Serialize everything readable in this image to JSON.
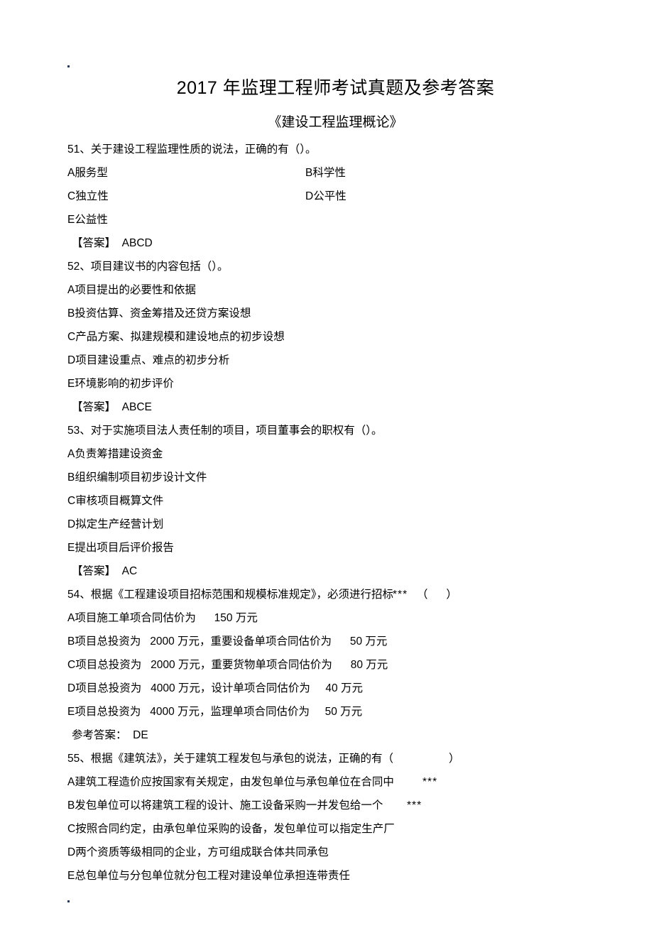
{
  "document": {
    "title": "2017 年监理工程师考试真题及参考答案",
    "subtitle": "《建设工程监理概论》",
    "margin_mark": "."
  },
  "questions": [
    {
      "stem": "51、关于建设工程监理性质的说法，正确的有（）。",
      "two_column": true,
      "options_left": [
        "A服务型",
        "C独立性",
        "E公益性"
      ],
      "options_right": [
        "B科学性",
        "D公平性",
        ""
      ],
      "answer_label": "【答案】",
      "answer_value": "ABCD"
    },
    {
      "stem": "52、项目建议书的内容包括（）。",
      "two_column": false,
      "options": [
        "A项目提出的必要性和依据",
        "B投资估算、资金筹措及还贷方案设想",
        "C产品方案、拟建规模和建设地点的初步设想",
        "D项目建设重点、难点的初步分析",
        "E环境影响的初步评价"
      ],
      "answer_label": "【答案】",
      "answer_value": "ABCE"
    },
    {
      "stem": "53、对于实施项目法人责任制的项目，项目董事会的职权有（）。",
      "two_column": false,
      "options": [
        "A负责筹措建设资金",
        "B组织编制项目初步设计文件",
        "C审核项目概算文件",
        "D拟定生产经营计划",
        "E提出项目后评价报告"
      ],
      "answer_label": "【答案】",
      "answer_value": "AC"
    },
    {
      "stem": "54、根据《工程建设项目招标范围和规模标准规定》，必须进行招标",
      "stem_stars": "***",
      "stem_tail": "（      ）",
      "two_column": false,
      "options": [
        "A项目施工单项合同估价为      150 万元",
        "B项目总投资为   2000 万元，重要设备单项合同估价为      50 万元",
        "C项目总投资为   2000 万元，重要货物单项合同估价为      80 万元",
        "D项目总投资为   4000 万元，设计单项合同估价为     40 万元",
        "E项目总投资为   4000 万元，监理单项合同估价为     50 万元"
      ],
      "answer_label": "参考答案：",
      "answer_value": "DE"
    },
    {
      "stem": "55、根据《建筑法》，关于建筑工程发包与承包的说法，正确的有（",
      "stem_tail": "）",
      "two_column": false,
      "options": [
        "A建筑工程造价应按国家有关规定，由发包单位与承包单位在合同中",
        "B发包单位可以将建筑工程的设计、施工设备采购一并发包给一个",
        "C按照合同约定，由承包单位采购的设备，发包单位可以指定生产厂",
        "D两个资质等级相同的企业，方可组成联合体共同承包",
        "E总包单位与分包单位就分包工程对建设单位承担连带责任"
      ],
      "option_stars": [
        "***",
        "***",
        "",
        "",
        ""
      ],
      "answer_label": "",
      "answer_value": ""
    }
  ]
}
